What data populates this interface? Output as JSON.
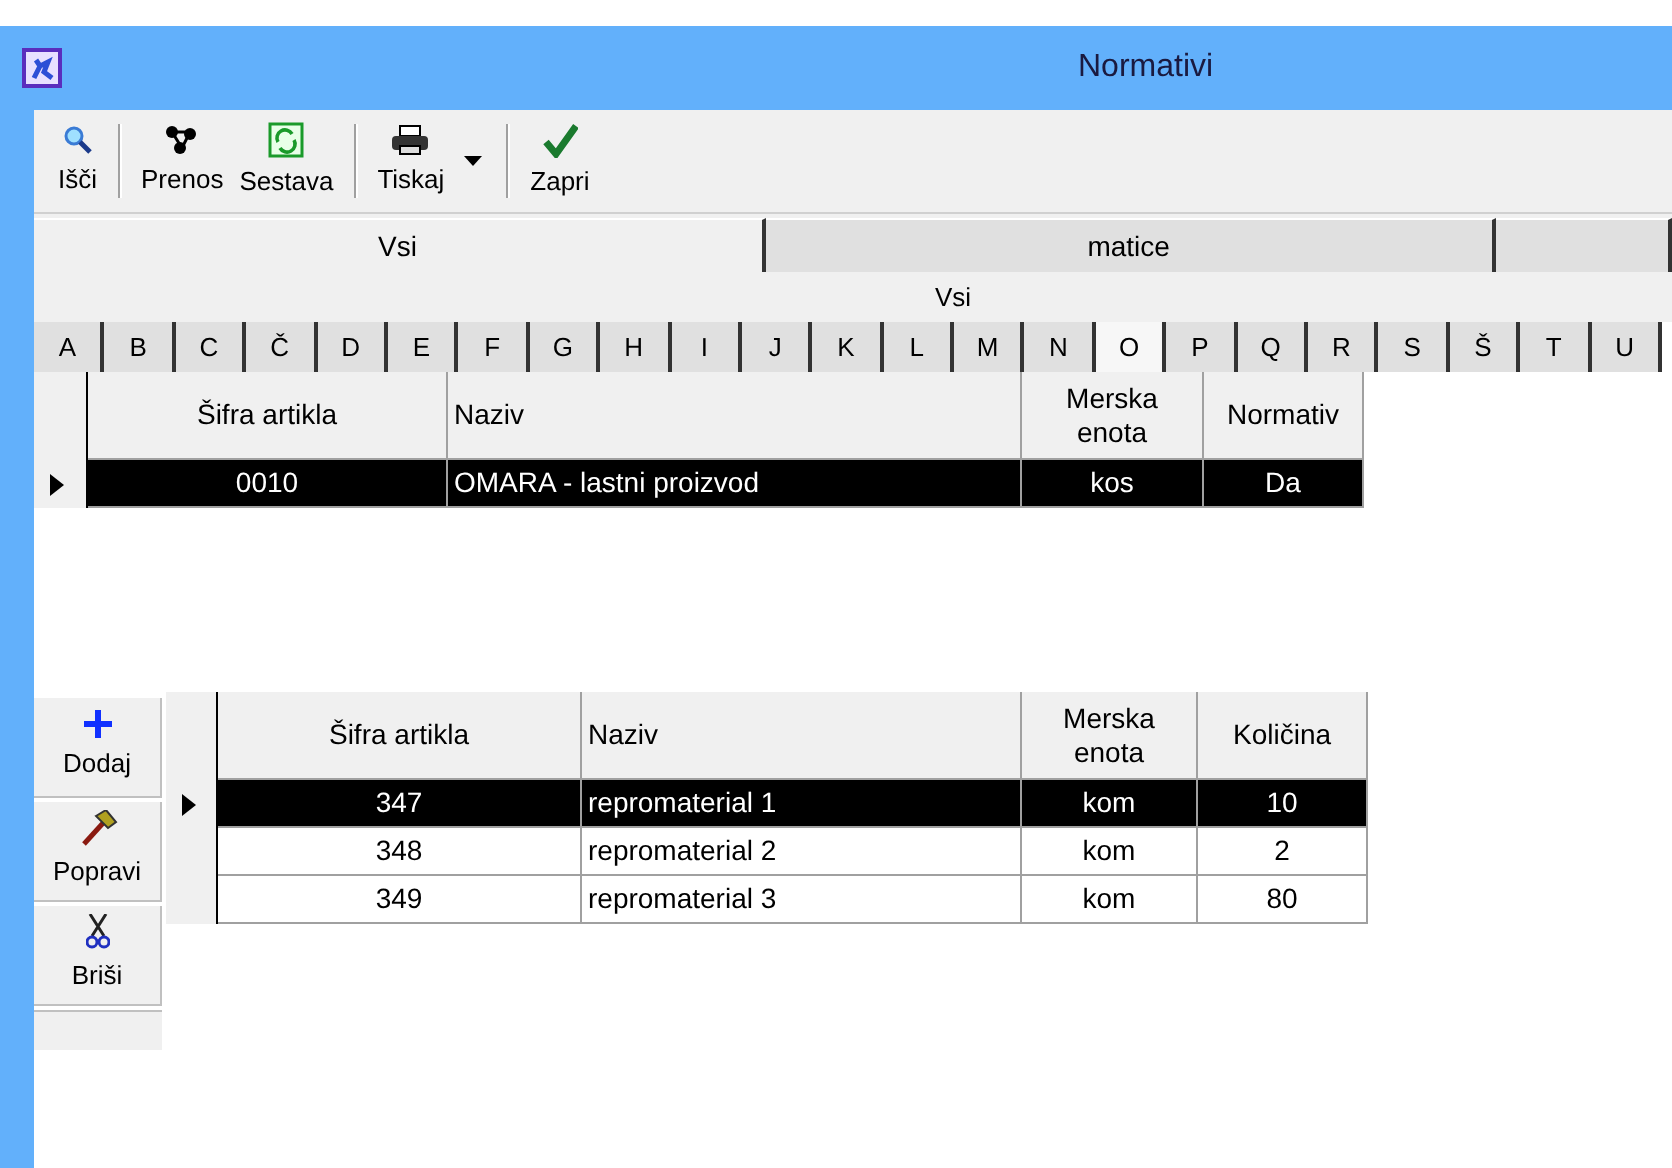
{
  "window": {
    "title": "Normativi"
  },
  "toolbar": [
    {
      "label": "Išči",
      "kind": "search"
    },
    {
      "label": "Prenos",
      "kind": "transfer"
    },
    {
      "label": "Sestava",
      "kind": "compose"
    },
    {
      "label": "Tiskaj",
      "kind": "print"
    },
    {
      "label": "Zapri",
      "kind": "close"
    }
  ],
  "tabs": [
    {
      "label": "Vsi",
      "selected": true
    },
    {
      "label": "matice",
      "selected": false
    },
    {
      "selected": false
    }
  ],
  "filter_label": "Vsi",
  "letters": [
    {
      "label": "A",
      "selected": false
    },
    {
      "label": "B",
      "selected": false
    },
    {
      "label": "C",
      "selected": false
    },
    {
      "label": "Č",
      "selected": false
    },
    {
      "label": "D",
      "selected": false
    },
    {
      "label": "E",
      "selected": false
    },
    {
      "label": "F",
      "selected": false
    },
    {
      "label": "G",
      "selected": false
    },
    {
      "label": "H",
      "selected": false
    },
    {
      "label": "I",
      "selected": false
    },
    {
      "label": "J",
      "selected": false
    },
    {
      "label": "K",
      "selected": false
    },
    {
      "label": "L",
      "selected": false
    },
    {
      "label": "M",
      "selected": false
    },
    {
      "label": "N",
      "selected": false
    },
    {
      "label": "O",
      "selected": true
    },
    {
      "label": "P",
      "selected": false
    },
    {
      "label": "Q",
      "selected": false
    },
    {
      "label": "R",
      "selected": false
    },
    {
      "label": "S",
      "selected": false
    },
    {
      "label": "Š",
      "selected": false
    },
    {
      "label": "T",
      "selected": false
    },
    {
      "label": "U",
      "selected": false
    }
  ],
  "articles": {
    "columns": [
      "Šifra artikla",
      "Naziv",
      "Merska enota",
      "Normativ"
    ],
    "rows": [
      {
        "cells": [
          "0010",
          "OMARA - lastni proizvod",
          "kos",
          "Da"
        ],
        "selected": true
      }
    ]
  },
  "side_buttons": [
    {
      "label": "Dodaj",
      "kind": "add"
    },
    {
      "label": "Popravi",
      "kind": "edit"
    },
    {
      "label": "Briši",
      "kind": "delete"
    }
  ],
  "components": {
    "columns": [
      "Šifra artikla",
      "Naziv",
      "Merska enota",
      "Količina"
    ],
    "rows": [
      {
        "cells": [
          "347",
          "repromaterial 1",
          "kom",
          "10"
        ],
        "selected": true
      },
      {
        "cells": [
          "348",
          "repromaterial 2",
          "kom",
          "2"
        ],
        "selected": false
      },
      {
        "cells": [
          "349",
          "repromaterial 3",
          "kom",
          "80"
        ],
        "selected": false
      }
    ]
  }
}
